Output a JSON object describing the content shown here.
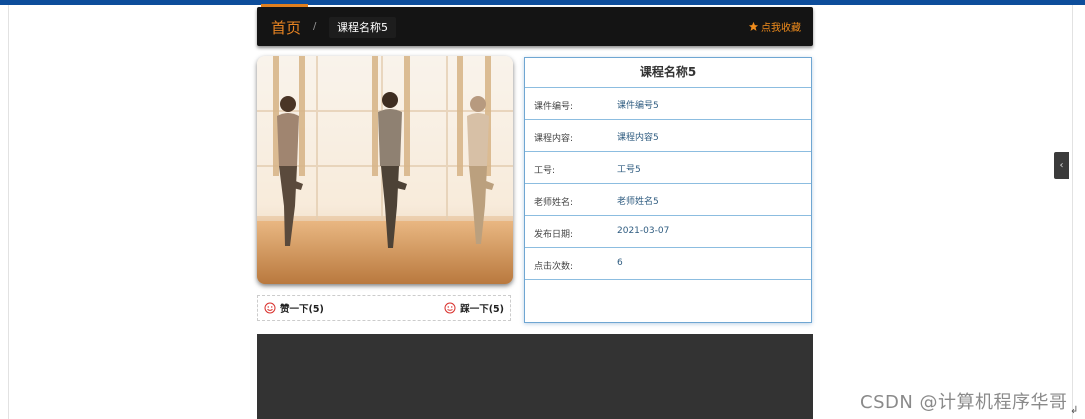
{
  "nav": {
    "home_label": "首页",
    "separator": "/",
    "breadcrumb": "课程名称5",
    "favorite_label": "点我收藏"
  },
  "votes": {
    "like_label": "赞一下(5)",
    "dislike_label": "踩一下(5)"
  },
  "detail": {
    "title": "课程名称5",
    "rows": [
      {
        "label": "课件编号:",
        "value": "课件编号5"
      },
      {
        "label": "课程内容:",
        "value": "课程内容5"
      },
      {
        "label": "工号:",
        "value": "工号5"
      },
      {
        "label": "老师姓名:",
        "value": "老师姓名5"
      },
      {
        "label": "发布日期:",
        "value": "2021-03-07"
      },
      {
        "label": "点击次数:",
        "value": "6"
      }
    ]
  },
  "side_tab": {
    "icon": "‹"
  },
  "watermark": "CSDN @计算机程序华哥",
  "colors": {
    "top_bar": "#0d4d9b",
    "nav_bg": "#141414",
    "accent_orange": "#e98422",
    "info_border": "#6fa6d2",
    "dark_panel": "#333333"
  }
}
